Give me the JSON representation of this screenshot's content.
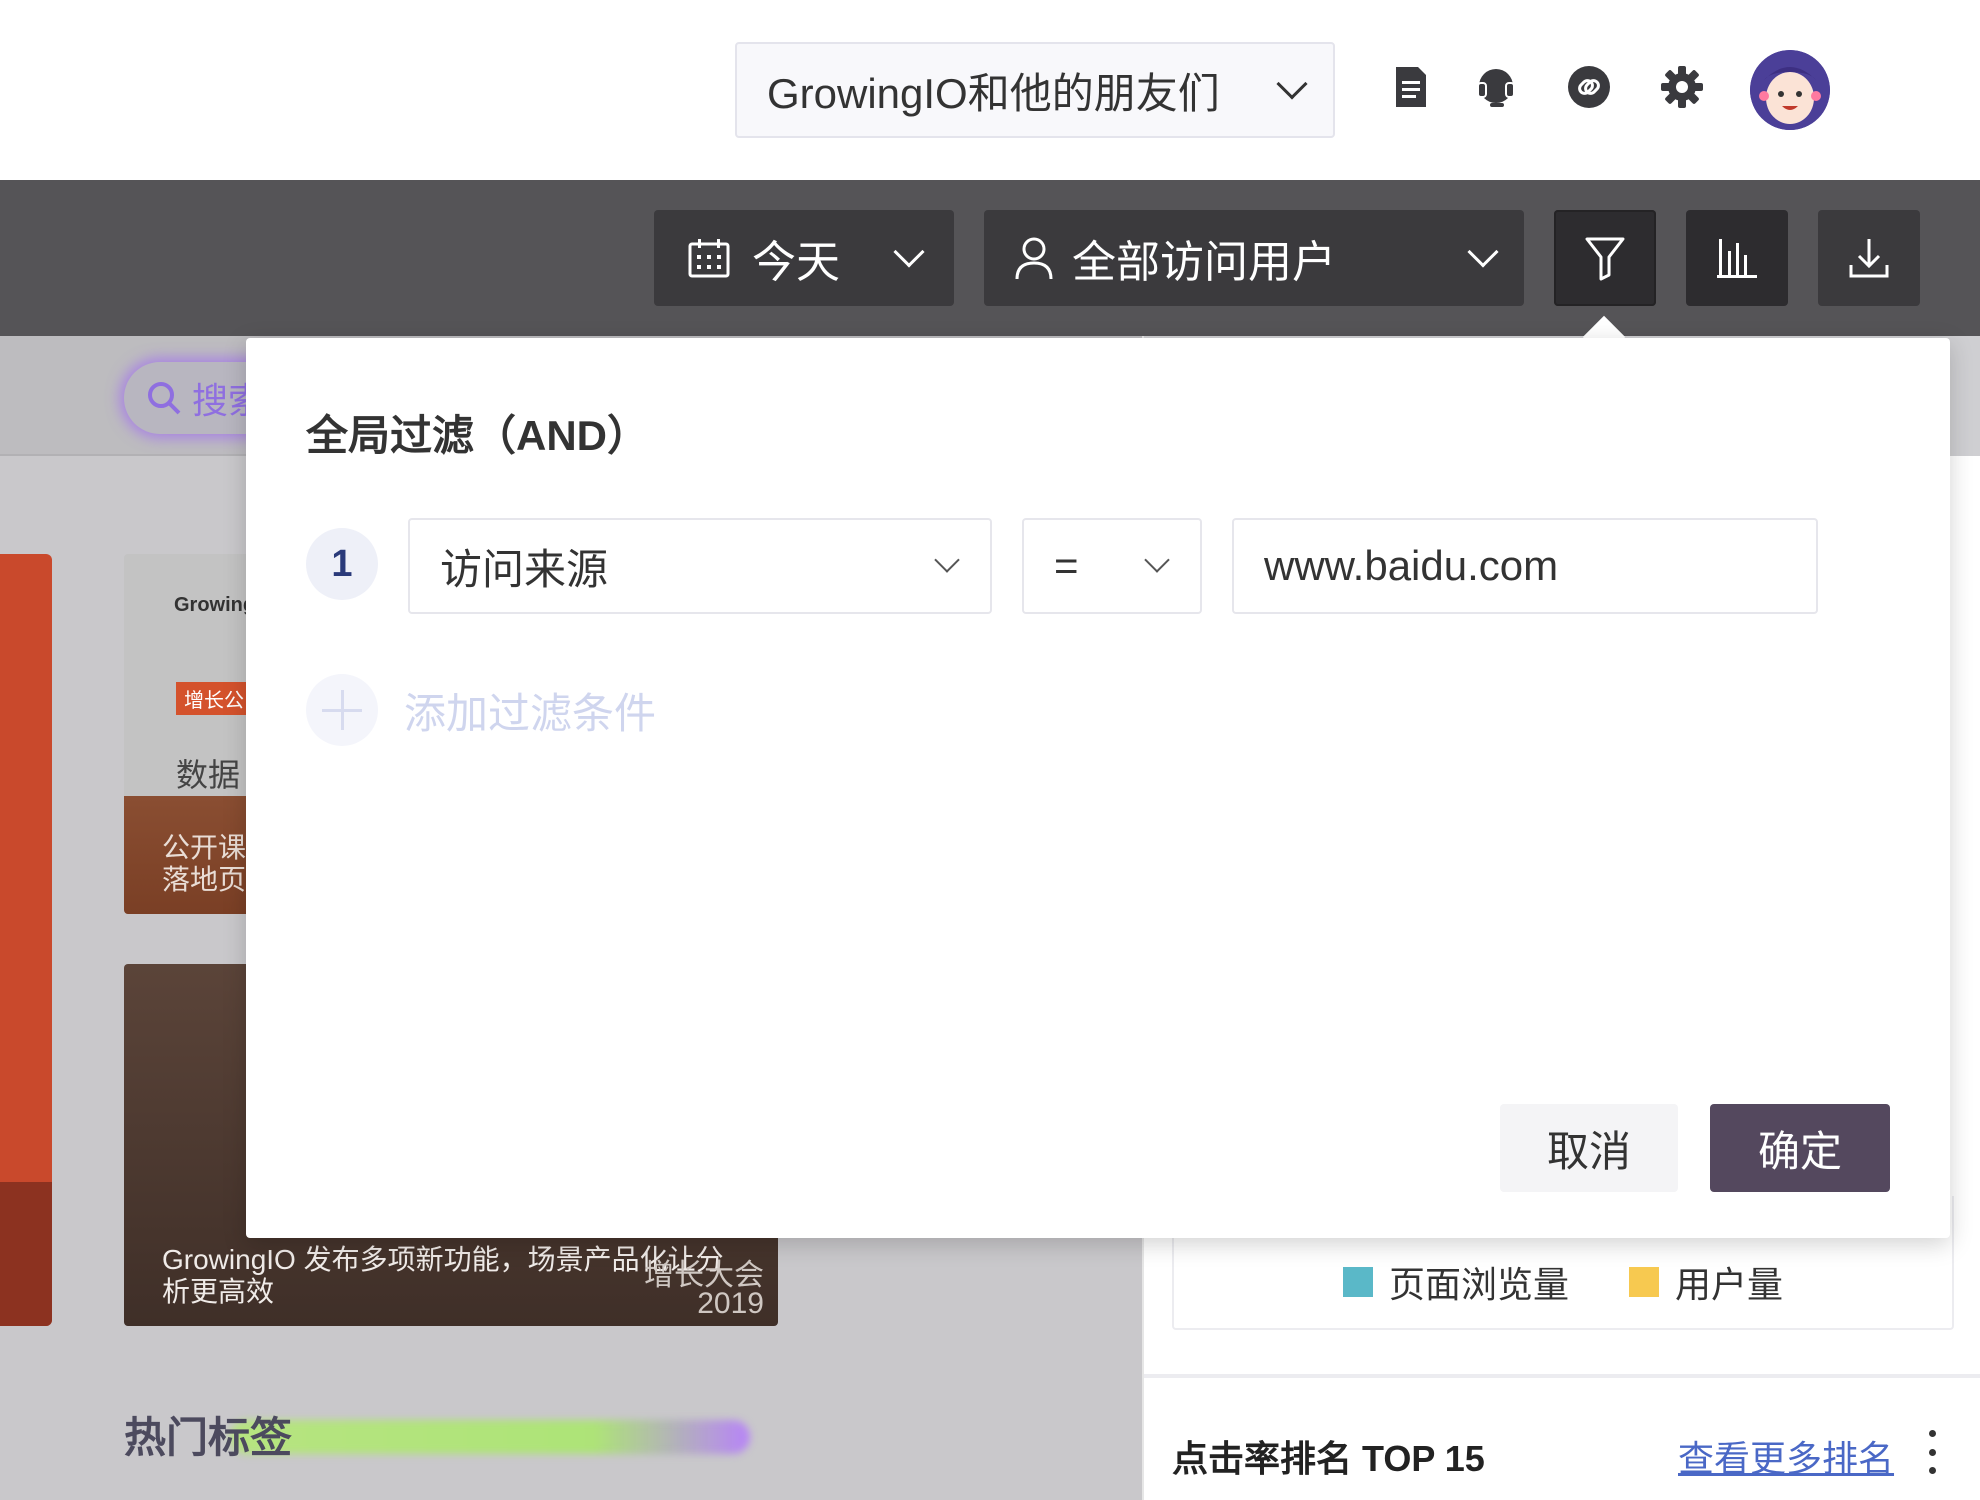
{
  "header": {
    "project_label": "GrowingIO和他的朋友们",
    "icons": [
      "document-icon",
      "headset-icon",
      "link-icon",
      "gear-icon",
      "avatar"
    ]
  },
  "toolbar": {
    "date_label": "今天",
    "user_segment_label": "全部访问用户",
    "icons": [
      "calendar-icon",
      "user-icon",
      "filter-icon",
      "bar-chart-icon",
      "download-icon"
    ]
  },
  "background": {
    "search_placeholder": "搜索",
    "card1": {
      "brand": "Growing",
      "tag": "增长公",
      "title": "数据",
      "bottom_line1": "公开课",
      "bottom_line2": "落地页"
    },
    "card2": {
      "caption": "GrowingIO 发布多项新功能，场景产品化让分析更高效",
      "conference_line1": "增长大会",
      "conference_line2": "2019"
    },
    "hot_tags_title": "热门标签",
    "legend": [
      {
        "label": "页面浏览量",
        "color": "#5ab8c8"
      },
      {
        "label": "用户量",
        "color": "#f7c950"
      }
    ],
    "rank_title": "点击率排名 TOP 15",
    "rank_link": "查看更多排名"
  },
  "filter_popup": {
    "title": "全局过滤（AND）",
    "conditions": [
      {
        "index": "1",
        "dimension": "访问来源",
        "operator": "=",
        "value": "www.baidu.com"
      }
    ],
    "add_condition_label": "添加过滤条件",
    "cancel_label": "取消",
    "confirm_label": "确定"
  },
  "colors": {
    "toolbar_bg": "#555457",
    "confirm_bg": "#54485e",
    "accent_orange": "#c9492c"
  }
}
